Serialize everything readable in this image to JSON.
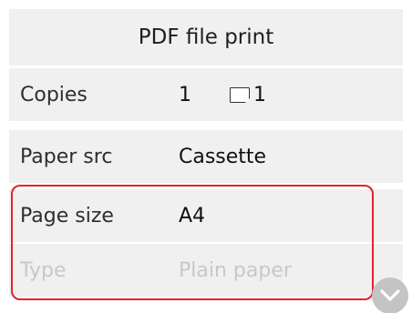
{
  "title": "PDF file print",
  "settings": [
    {
      "label": "Copies",
      "value": "1",
      "paper_count": "1"
    },
    {
      "label": "Paper src",
      "value": "Cassette"
    },
    {
      "label": "Page size",
      "value": "A4"
    },
    {
      "label": "Type",
      "value": "Plain paper",
      "state": "disabled"
    }
  ],
  "icons": {
    "paper_sheet": "paper-sheet-icon",
    "scroll_down": "chevron-down-icon"
  },
  "colors": {
    "highlight_border": "#e4222c",
    "row_background": "#f0f0f0",
    "disabled_text": "#c8c8c8"
  }
}
